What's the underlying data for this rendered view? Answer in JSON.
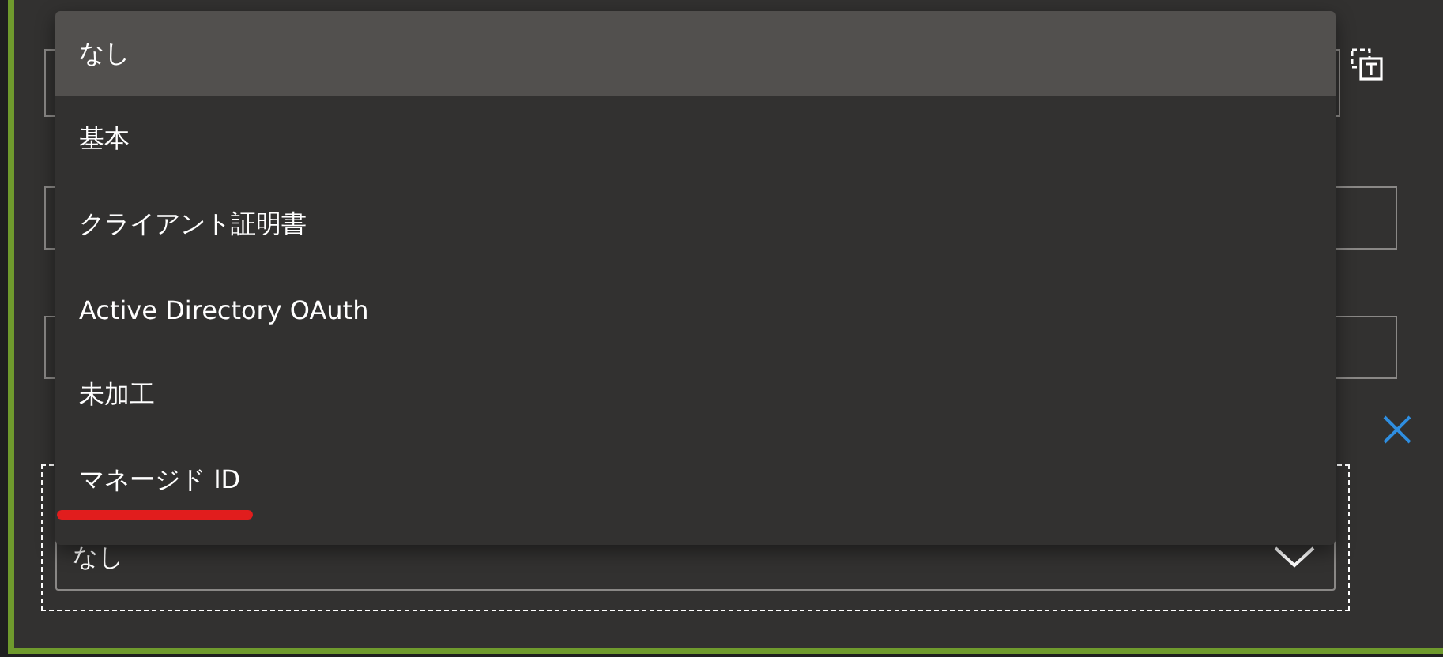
{
  "form": {
    "fields": [
      {
        "kind": "with-icon"
      },
      {
        "kind": "plain"
      },
      {
        "kind": "plain"
      }
    ],
    "auth": {
      "value": "なし"
    }
  },
  "dropdown": {
    "options": [
      {
        "label": "なし",
        "selected": true,
        "underlined": false
      },
      {
        "label": "基本",
        "selected": false,
        "underlined": false
      },
      {
        "label": "クライアント証明書",
        "selected": false,
        "underlined": false
      },
      {
        "label": "Active Directory OAuth",
        "selected": false,
        "underlined": false
      },
      {
        "label": "未加工",
        "selected": false,
        "underlined": false
      },
      {
        "label": "マネージド ID",
        "selected": false,
        "underlined": true
      }
    ]
  }
}
